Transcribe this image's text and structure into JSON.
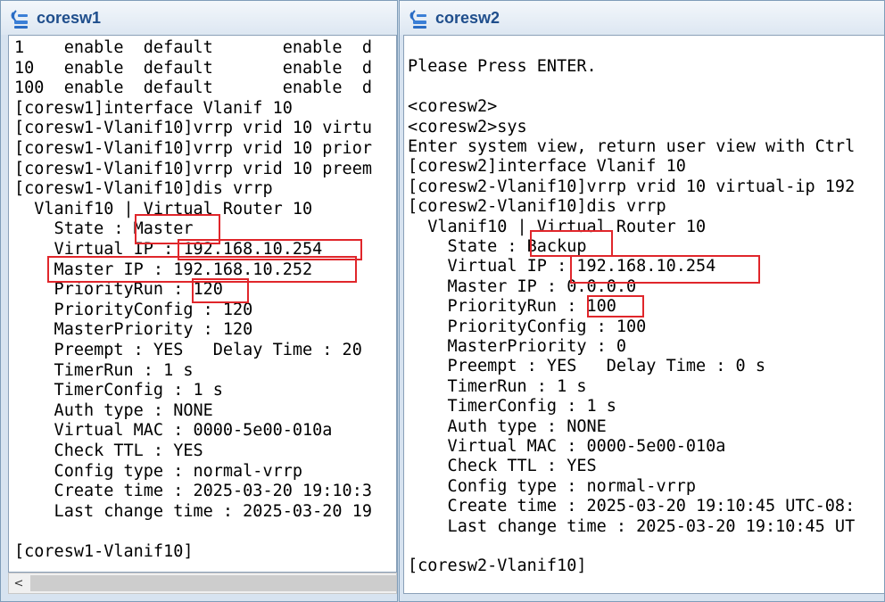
{
  "windows": [
    {
      "title": "coresw1",
      "lines": [
        "1    enable  default       enable  d",
        "10   enable  default       enable  d",
        "100  enable  default       enable  d",
        "[coresw1]interface Vlanif 10",
        "[coresw1-Vlanif10]vrrp vrid 10 virtu",
        "[coresw1-Vlanif10]vrrp vrid 10 prior",
        "[coresw1-Vlanif10]vrrp vrid 10 preem",
        "[coresw1-Vlanif10]dis vrrp",
        "  Vlanif10 | Virtual Router 10",
        "    State : Master",
        "    Virtual IP : 192.168.10.254",
        "    Master IP : 192.168.10.252",
        "    PriorityRun : 120",
        "    PriorityConfig : 120",
        "    MasterPriority : 120",
        "    Preempt : YES   Delay Time : 20",
        "    TimerRun : 1 s",
        "    TimerConfig : 1 s",
        "    Auth type : NONE",
        "    Virtual MAC : 0000-5e00-010a",
        "    Check TTL : YES",
        "    Config type : normal-vrrp",
        "    Create time : 2025-03-20 19:10:3",
        "    Last change time : 2025-03-20 19",
        "",
        "[coresw1-Vlanif10]"
      ]
    },
    {
      "title": "coresw2",
      "lines": [
        "",
        "Please Press ENTER.",
        "",
        "<coresw2>",
        "<coresw2>sys",
        "Enter system view, return user view with Ctrl",
        "[coresw2]interface Vlanif 10",
        "[coresw2-Vlanif10]vrrp vrid 10 virtual-ip 192",
        "[coresw2-Vlanif10]dis vrrp",
        "  Vlanif10 | Virtual Router 10",
        "    State : Backup",
        "    Virtual IP : 192.168.10.254",
        "    Master IP : 0.0.0.0",
        "    PriorityRun : 100",
        "    PriorityConfig : 100",
        "    MasterPriority : 0",
        "    Preempt : YES   Delay Time : 0 s",
        "    TimerRun : 1 s",
        "    TimerConfig : 1 s",
        "    Auth type : NONE",
        "    Virtual MAC : 0000-5e00-010a",
        "    Check TTL : YES",
        "    Config type : normal-vrrp",
        "    Create time : 2025-03-20 19:10:45 UTC-08:",
        "    Last change time : 2025-03-20 19:10:45 UT",
        "",
        "[coresw2-Vlanif10]"
      ]
    }
  ],
  "scrollbar": {
    "left_arrow": "<"
  },
  "colors": {
    "highlight": "#e0262b",
    "title": "#1f4e8c"
  },
  "icons": {
    "app": "network-device-icon"
  }
}
